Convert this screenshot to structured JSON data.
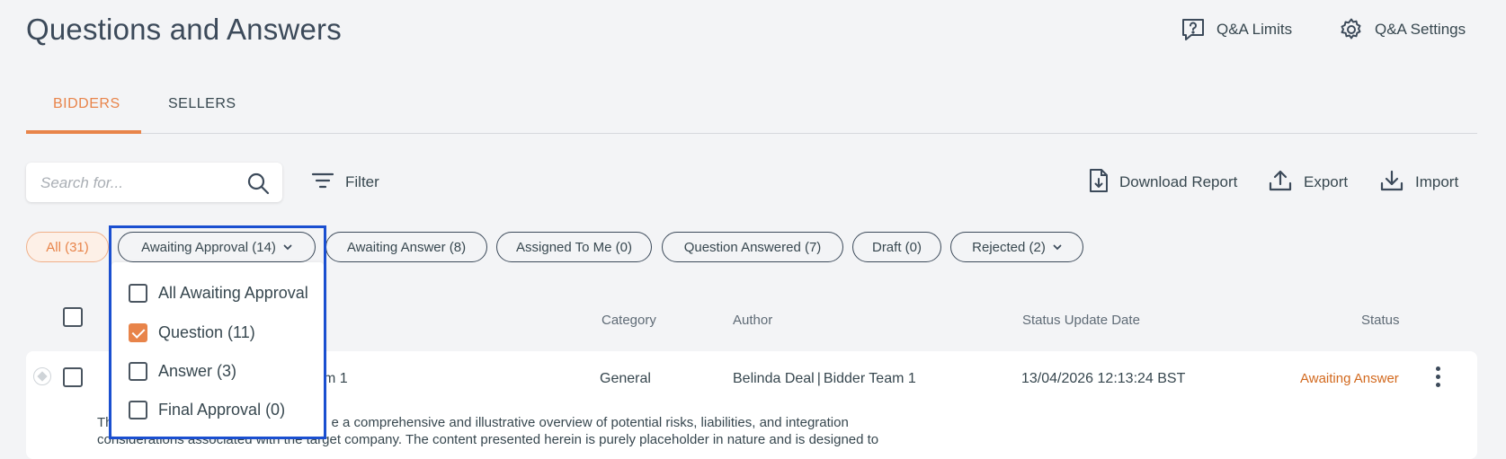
{
  "header": {
    "title": "Questions and Answers",
    "actions": [
      {
        "label": "Q&A Limits",
        "icon": "message-question-icon"
      },
      {
        "label": "Q&A Settings",
        "icon": "gear-icon"
      }
    ]
  },
  "tabs": [
    {
      "label": "BIDDERS",
      "active": true
    },
    {
      "label": "SELLERS",
      "active": false
    }
  ],
  "toolbar": {
    "search_placeholder": "Search for...",
    "filter_label": "Filter",
    "download_report_label": "Download Report",
    "export_label": "Export",
    "import_label": "Import"
  },
  "chips": [
    {
      "label": "All (31)",
      "active": true
    },
    {
      "label": "Awaiting Approval (14)",
      "has_dropdown": true
    },
    {
      "label": "Awaiting Answer (8)"
    },
    {
      "label": "Assigned To Me (0)"
    },
    {
      "label": "Question Answered (7)"
    },
    {
      "label": "Draft (0)"
    },
    {
      "label": "Rejected (2)",
      "has_dropdown": true
    }
  ],
  "dropdown": {
    "items": [
      {
        "label": "All Awaiting Approval",
        "checked": false
      },
      {
        "label": "Question (11)",
        "checked": true
      },
      {
        "label": "Answer (3)",
        "checked": false
      },
      {
        "label": "Final Approval (0)",
        "checked": false
      }
    ]
  },
  "table": {
    "columns": {
      "category": "Category",
      "author": "Author",
      "status_update_date": "Status Update Date",
      "status": "Status"
    },
    "rows": [
      {
        "title_fragment": "m 1",
        "category": "General",
        "author_name": "Belinda Deal",
        "author_team": "Bidder Team 1",
        "date": "13/04/2026 12:13:24 BST",
        "status": "Awaiting Answer",
        "desc_line1_start": "Th",
        "desc_line1_end": "e a comprehensive and illustrative overview of potential risks, liabilities, and integration",
        "desc_line2": "considerations associated with the target company. The content presented herein is purely placeholder in nature and is designed to"
      }
    ]
  },
  "colors": {
    "accent": "#e8844a",
    "status_awaiting": "#d2691e",
    "highlight_border": "#1a4fd0",
    "text": "#37474f"
  }
}
